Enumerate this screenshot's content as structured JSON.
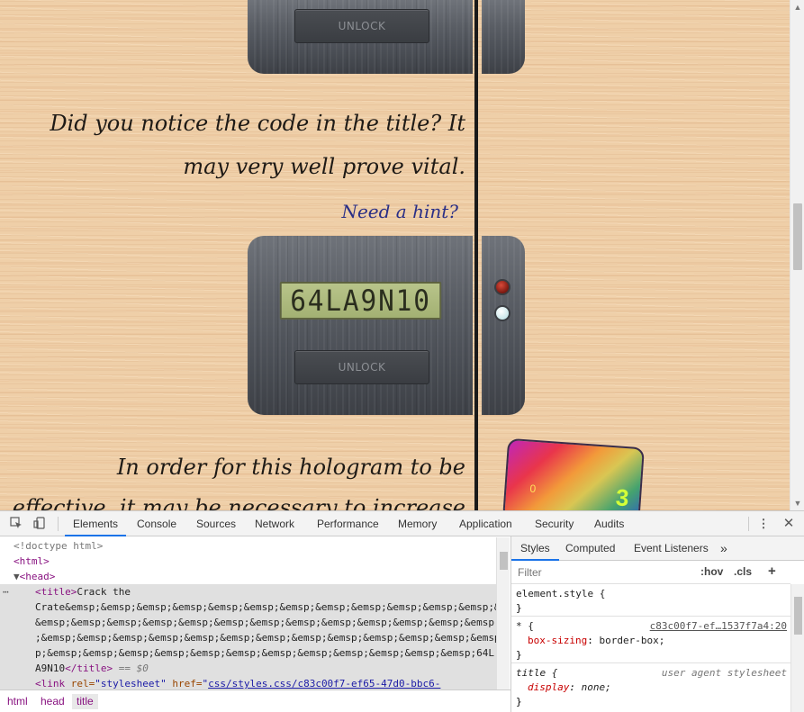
{
  "page": {
    "crate1": {
      "unlock_label": "UNLOCK"
    },
    "paragraph1": {
      "line1": "Did you notice the code in the title? It",
      "line2": "may very well prove vital."
    },
    "hint_link": "Need a hint?",
    "crate2": {
      "lcd_display": "64LA9N10",
      "unlock_label": "UNLOCK"
    },
    "paragraph2": {
      "line1": "In order for this hologram to be",
      "line2": "effective, it may be necessary to increase"
    },
    "hologram": {
      "glyph1": "3",
      "glyph2": "0"
    },
    "colors": {
      "led_red": "#c23a2c",
      "led_white": "#e8f6f7",
      "hint_color": "#2a2f86",
      "wood": "#efcfa8"
    }
  },
  "devtools": {
    "tabs": [
      "Elements",
      "Console",
      "Sources",
      "Network",
      "Performance",
      "Memory",
      "Application",
      "Security",
      "Audits"
    ],
    "active_tab": "Elements",
    "icons": [
      "inspect-element-icon",
      "device-toolbar-icon",
      "more-options-icon",
      "close-icon"
    ],
    "elements": {
      "doctype": "<!doctype html>",
      "html_open": "<html>",
      "head_open": "<head>",
      "title_open": "<title>",
      "title_text_l1": "Crack the",
      "title_text_l2": "Crate&emsp;&emsp;&emsp;&emsp;&emsp;&emsp;&emsp;&emsp;&emsp;&emsp;&emsp;&emsp;&emsp;",
      "title_text_l3": "&emsp;&emsp;&emsp;&emsp;&emsp;&emsp;&emsp;&emsp;&emsp;&emsp;&emsp;&emsp;&emsp;&emsp;",
      "title_text_l4": ";&emsp;&emsp;&emsp;&emsp;&emsp;&emsp;&emsp;&emsp;&emsp;&emsp;&emsp;&emsp;&emsp;&ems",
      "title_text_l5": "p;&emsp;&emsp;&emsp;&emsp;&emsp;&emsp;&emsp;&emsp;&emsp;&emsp;&emsp;&emsp;64L",
      "title_text_l6": "A9N10",
      "title_close": "</title>",
      "eq_marker": "== $0",
      "link_line_tag": "<link",
      "link_rel_attr": "rel=",
      "link_rel_val": "\"stylesheet\"",
      "link_href_attr": "href=",
      "link_href_val": "css/styles.css/c83c00f7-ef65-47d0-bbc6-"
    },
    "breadcrumbs": [
      "html",
      "head",
      "title"
    ],
    "styles_tabs": [
      "Styles",
      "Computed",
      "Event Listeners"
    ],
    "styles_more": "»",
    "filter_placeholder": "Filter",
    "hov_label": ":hov",
    "cls_label": ".cls",
    "add_label": "+",
    "rules": [
      {
        "selector": "element.style {",
        "close": "}"
      },
      {
        "selector": "* {",
        "source": "c83c00f7-ef…1537f7a4:20",
        "prop": "box-sizing",
        "value": "border-box;",
        "close": "}"
      },
      {
        "selector": "title {",
        "source": "user agent stylesheet",
        "prop": "display",
        "value": "none;",
        "close": "}"
      }
    ]
  }
}
